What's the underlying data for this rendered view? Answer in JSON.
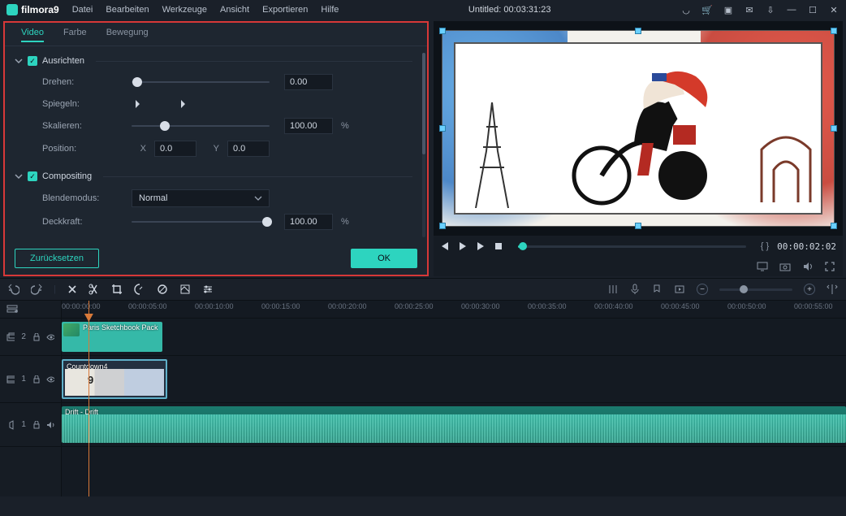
{
  "app": {
    "name": "filmora9",
    "title_center": "Untitled: 00:03:31:23"
  },
  "menu": [
    "Datei",
    "Bearbeiten",
    "Werkzeuge",
    "Ansicht",
    "Exportieren",
    "Hilfe"
  ],
  "panel": {
    "tabs": [
      "Video",
      "Farbe",
      "Bewegung"
    ],
    "active_tab": 0,
    "sections": {
      "align": {
        "title": "Ausrichten",
        "checked": true
      },
      "comp": {
        "title": "Compositing",
        "checked": true
      }
    },
    "labels": {
      "rotate": "Drehen:",
      "mirror": "Spiegeln:",
      "scale": "Skalieren:",
      "position": "Position:",
      "blend": "Blendemodus:",
      "opacity": "Deckkraft:",
      "pos_x": "X",
      "pos_y": "Y",
      "percent": "%"
    },
    "values": {
      "rotate": "0.00",
      "scale": "100.00",
      "pos_x": "0.0",
      "pos_y": "0.0",
      "blend": "Normal",
      "opacity": "100.00"
    },
    "buttons": {
      "reset": "Zurücksetzen",
      "ok": "OK"
    }
  },
  "preview": {
    "timecode": "00:00:02:02",
    "braces": "{  }"
  },
  "ruler_ticks": [
    "00:00:00:00",
    "00:00:05:00",
    "00:00:10:00",
    "00:00:15:00",
    "00:00:20:00",
    "00:00:25:00",
    "00:00:30:00",
    "00:00:35:00",
    "00:00:40:00",
    "00:00:45:00",
    "00:00:50:00",
    "00:00:55:00"
  ],
  "tracks": {
    "t2": {
      "label": "2",
      "icon": "overlay"
    },
    "t1": {
      "label": "1",
      "icon": "video"
    },
    "a1": {
      "label": "1",
      "icon": "audio"
    }
  },
  "clips": {
    "overlay": "Paris Sketchbook Pack",
    "video": "Countdown4",
    "audio": "Drift - Drift"
  },
  "playhead_pct": 3.4
}
